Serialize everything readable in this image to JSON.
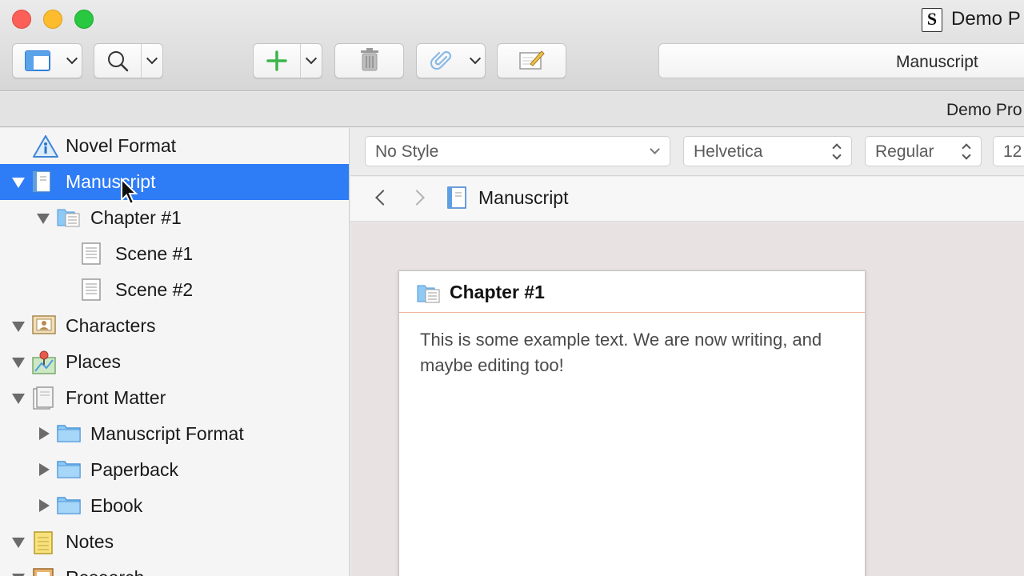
{
  "window": {
    "title": "Demo P",
    "subtitle": "Demo Pro"
  },
  "toolbar": {
    "view_icon": "binder-layout-icon",
    "search_icon": "search-icon",
    "add_icon": "plus-icon",
    "trash_icon": "trash-icon",
    "attach_icon": "paperclip-icon",
    "edit_icon": "compose-icon",
    "document_title": "Manuscript"
  },
  "binder": {
    "items": [
      {
        "label": "Novel Format",
        "icon": "warning-info-icon",
        "level": 0,
        "disclosure": "none",
        "selected": false
      },
      {
        "label": "Manuscript",
        "icon": "draft-folder-icon",
        "level": 0,
        "disclosure": "expanded",
        "selected": true
      },
      {
        "label": "Chapter #1",
        "icon": "chapter-folder-icon",
        "level": 1,
        "disclosure": "expanded",
        "selected": false
      },
      {
        "label": "Scene #1",
        "icon": "text-document-icon",
        "level": 2,
        "disclosure": "none",
        "selected": false
      },
      {
        "label": "Scene #2",
        "icon": "text-document-icon",
        "level": 2,
        "disclosure": "none",
        "selected": false
      },
      {
        "label": "Characters",
        "icon": "character-card-icon",
        "level": 0,
        "disclosure": "expanded",
        "selected": false
      },
      {
        "label": "Places",
        "icon": "map-pin-icon",
        "level": 0,
        "disclosure": "expanded",
        "selected": false
      },
      {
        "label": "Front Matter",
        "icon": "front-matter-icon",
        "level": 0,
        "disclosure": "expanded",
        "selected": false
      },
      {
        "label": "Manuscript Format",
        "icon": "folder-icon",
        "level": 1,
        "disclosure": "collapsed",
        "selected": false
      },
      {
        "label": "Paperback",
        "icon": "folder-icon",
        "level": 1,
        "disclosure": "collapsed",
        "selected": false
      },
      {
        "label": "Ebook",
        "icon": "folder-icon",
        "level": 1,
        "disclosure": "collapsed",
        "selected": false
      },
      {
        "label": "Notes",
        "icon": "notepad-icon",
        "level": 0,
        "disclosure": "expanded",
        "selected": false
      },
      {
        "label": "Research",
        "icon": "research-icon",
        "level": 0,
        "disclosure": "expanded",
        "selected": false
      }
    ]
  },
  "format_bar": {
    "style": "No Style",
    "font": "Helvetica",
    "weight": "Regular",
    "size": "12"
  },
  "editor": {
    "header_title": "Manuscript",
    "card": {
      "title": "Chapter #1",
      "body": "This is some example text. We are now writing, and maybe editing too!"
    }
  },
  "colors": {
    "selection": "#2e7cf6",
    "add_green": "#3cb54a",
    "folder_blue": "#8fc9f5",
    "card_divider": "#f0b49a",
    "canvas_bg": "#e8e2e2"
  }
}
